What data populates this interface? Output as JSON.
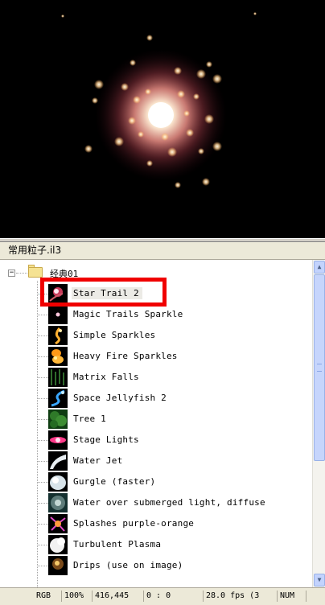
{
  "preview": {
    "alt": "particle preview",
    "colors": {
      "background": "#000000",
      "core": "#fff1d8",
      "glow": "#c4454a",
      "sparkle": "#ffd59a"
    }
  },
  "file_header": {
    "title": "常用粒子.il3"
  },
  "tree": {
    "root": {
      "label": "经典01",
      "expander": "−",
      "icon": "folder-icon"
    },
    "items": [
      {
        "label": "Star Trail 2",
        "icon": "star-trail-thumbnail"
      },
      {
        "label": "Magic Trails Sparkle",
        "icon": "magic-trails-thumbnail"
      },
      {
        "label": "Simple Sparkles",
        "icon": "simple-sparkles-thumbnail"
      },
      {
        "label": "Heavy Fire Sparkles",
        "icon": "heavy-fire-thumbnail"
      },
      {
        "label": "Matrix Falls",
        "icon": "matrix-falls-thumbnail"
      },
      {
        "label": "Space Jellyfish 2",
        "icon": "space-jellyfish-thumbnail"
      },
      {
        "label": "Tree 1",
        "icon": "tree-thumbnail"
      },
      {
        "label": "Stage Lights",
        "icon": "stage-lights-thumbnail"
      },
      {
        "label": "Water Jet",
        "icon": "water-jet-thumbnail"
      },
      {
        "label": "Gurgle (faster)",
        "icon": "gurgle-thumbnail"
      },
      {
        "label": "Water over submerged light, diffuse",
        "icon": "water-submerged-thumbnail"
      },
      {
        "label": "Splashes purple-orange",
        "icon": "splashes-thumbnail"
      },
      {
        "label": "Turbulent Plasma",
        "icon": "turbulent-plasma-thumbnail"
      },
      {
        "label": "Drips (use on image)",
        "icon": "drips-thumbnail"
      }
    ],
    "selected_index": 0,
    "highlight_color": "#f00000"
  },
  "scrollbar": {
    "up": "▲",
    "down": "▼"
  },
  "status": {
    "mode": "RGB",
    "zoom": "100%",
    "coords": "416,445",
    "ratio": "0 : 0",
    "fps": "28.0 fps (3",
    "num": "NUM"
  }
}
